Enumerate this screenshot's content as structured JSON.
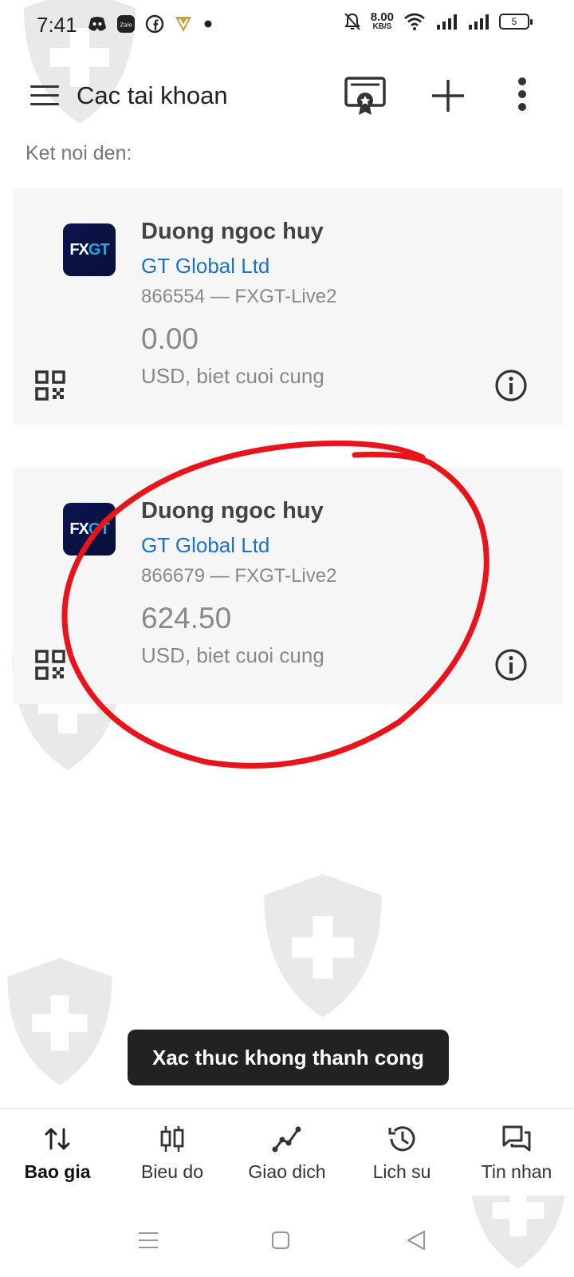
{
  "status_bar": {
    "time": "7:41",
    "left_icons": [
      "discord-icon",
      "zalo-icon",
      "facebook-icon",
      "vpn-icon",
      "dot-icon"
    ],
    "net_speed_value": "8.00",
    "net_speed_unit": "KB/S",
    "battery_level": "5"
  },
  "app_bar": {
    "title": "Cac tai khoan"
  },
  "connect_label": "Ket noi den:",
  "accounts": [
    {
      "name": "Duong ngoc huy",
      "broker": "GT Global Ltd",
      "number": "866554 — FXGT-Live2",
      "balance": "0.00",
      "currency_note": "USD, biet cuoi cung",
      "logo_fx": "FX",
      "logo_gt": "GT"
    },
    {
      "name": "Duong ngoc huy",
      "broker": "GT Global Ltd",
      "number": "866679 — FXGT-Live2",
      "balance": "624.50",
      "currency_note": "USD, biet cuoi cung",
      "logo_fx": "FX",
      "logo_gt": "GT"
    }
  ],
  "toast": "Xac thuc khong thanh cong",
  "bottom_nav": [
    {
      "label": "Bao gia",
      "icon": "quotes-icon",
      "active": true
    },
    {
      "label": "Bieu do",
      "icon": "chart-icon",
      "active": false
    },
    {
      "label": "Giao dich",
      "icon": "trade-icon",
      "active": false
    },
    {
      "label": "Lich su",
      "icon": "history-icon",
      "active": false
    },
    {
      "label": "Tin nhan",
      "icon": "messages-icon",
      "active": false
    }
  ],
  "colors": {
    "broker_link": "#1a73c8",
    "annotation": "#e8141b",
    "card_bg": "#f6f6f6",
    "toast_bg": "#222222"
  }
}
